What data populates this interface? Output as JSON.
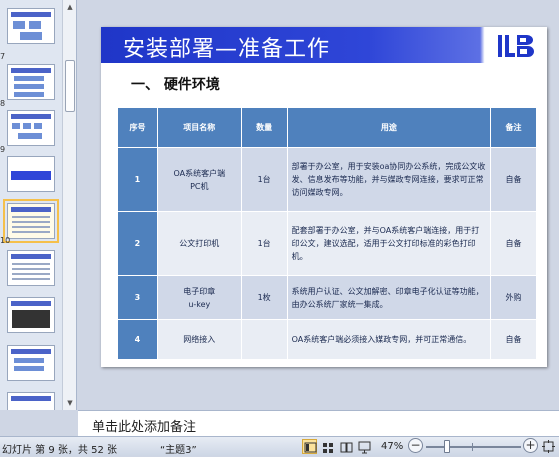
{
  "thumbnails": {
    "numbers": [
      "7",
      "8",
      "9",
      "10"
    ],
    "selected_index": 4
  },
  "slide": {
    "title": "安装部署—准备工作",
    "logo_text": "iLB",
    "section_heading": "一、 硬件环境",
    "table": {
      "headers": [
        "序号",
        "项目名称",
        "数量",
        "用途",
        "备注"
      ],
      "rows": [
        {
          "no": "1",
          "name_line1": "OA系统客户端",
          "name_line2": "PC机",
          "qty": "1台",
          "usage": "部署于办公室，用于安装oa协同办公系统，完成公文收发、信息发布等功能，并与媒政专网连接，要求可正常访问媒政专网。",
          "note": "自备"
        },
        {
          "no": "2",
          "name_line1": "公文打印机",
          "name_line2": "",
          "qty": "1台",
          "usage": "配套部署于办公室，并与OA系统客户端连接，用于打印公文，建议选配，适用于公文打印标准的彩色打印机。",
          "note": "自备"
        },
        {
          "no": "3",
          "name_line1": "电子印章",
          "name_line2": "u-key",
          "qty": "1枚",
          "usage": "系统用户认证、公文加解密、印章电子化认证等功能，由办公系统厂家统一集成。",
          "note": "外购"
        },
        {
          "no": "4",
          "name_line1": "网络接入",
          "name_line2": "",
          "qty": "",
          "usage": "OA系统客户端必须接入媒政专网，并可正常通信。",
          "note": "自备"
        }
      ]
    }
  },
  "notes": {
    "placeholder": "单击此处添加备注"
  },
  "status": {
    "slide_info": "幻灯片 第 9 张，共 52 张",
    "theme": "“主题3”",
    "zoom": "47%",
    "zoom_out": "−",
    "zoom_in": "+"
  },
  "colors": {
    "title_bar": "#1f36c8",
    "table_header": "#4f81bd",
    "row_odd": "#d0d8e8",
    "row_even": "#e9edf4",
    "selected_thumb": "#f5c04a"
  }
}
